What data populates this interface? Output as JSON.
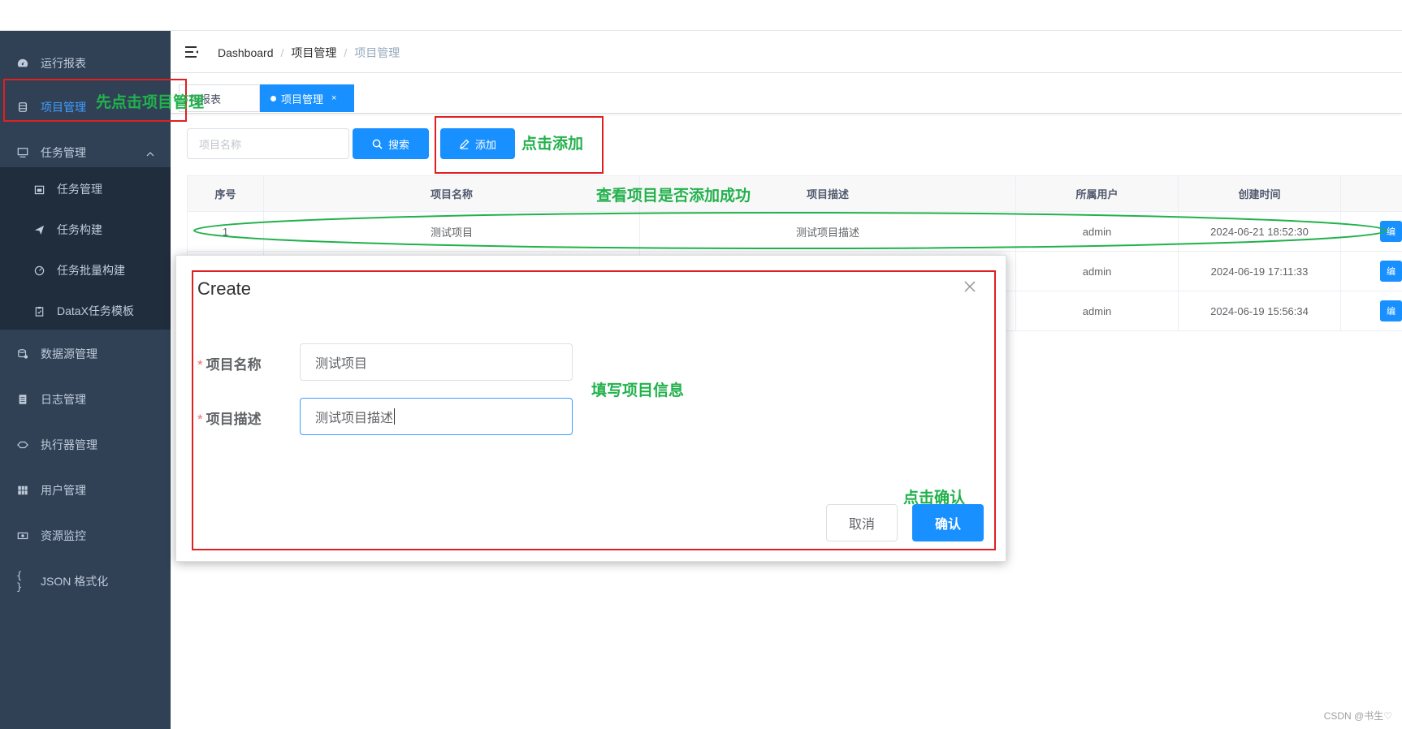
{
  "sidebar": {
    "items": [
      {
        "label": "运行报表",
        "icon": "dashboard-icon"
      },
      {
        "label": "项目管理",
        "icon": "database-icon",
        "active": true
      },
      {
        "label": "任务管理",
        "icon": "monitor-icon"
      },
      {
        "label": "数据源管理",
        "icon": "datasource-icon"
      },
      {
        "label": "日志管理",
        "icon": "document-icon"
      },
      {
        "label": "执行器管理",
        "icon": "executor-icon"
      },
      {
        "label": "用户管理",
        "icon": "users-icon"
      },
      {
        "label": "资源监控",
        "icon": "monitor-resource-icon"
      },
      {
        "label": "JSON 格式化",
        "icon": "braces-icon"
      }
    ],
    "task_submenu": [
      {
        "label": "任务管理",
        "icon": "calendar-icon"
      },
      {
        "label": "任务构建",
        "icon": "send-icon"
      },
      {
        "label": "任务批量构建",
        "icon": "gauge-icon"
      },
      {
        "label": "DataX任务模板",
        "icon": "clipboard-icon"
      }
    ]
  },
  "breadcrumb": [
    "Dashboard",
    "项目管理",
    "项目管理"
  ],
  "tags": [
    {
      "label": "行报表"
    },
    {
      "label": "项目管理",
      "active": true,
      "close": "×"
    }
  ],
  "filter": {
    "placeholder": "项目名称",
    "search_label": "搜索",
    "add_label": "添加"
  },
  "table": {
    "headers": [
      "序号",
      "项目名称",
      "项目描述",
      "所属用户",
      "创建时间"
    ],
    "rows": [
      {
        "index": "1",
        "name": "测试项目",
        "desc": "测试项目描述",
        "user": "admin",
        "created": "2024-06-21 18:52:30",
        "edit": "编"
      },
      {
        "index": "",
        "name": "",
        "desc": "",
        "user": "admin",
        "created": "2024-06-19 17:11:33",
        "edit": "编"
      },
      {
        "index": "",
        "name": "",
        "desc": "",
        "user": "admin",
        "created": "2024-06-19 15:56:34",
        "edit": "编"
      }
    ]
  },
  "dialog": {
    "title": "Create",
    "fields": [
      {
        "label": "项目名称",
        "value": "测试项目"
      },
      {
        "label": "项目描述",
        "value": "测试项目描述"
      }
    ],
    "required_mark": "*",
    "cancel_label": "取消",
    "confirm_label": "确认"
  },
  "annotations": {
    "click_project": "先点击项目管理",
    "click_add": "点击添加",
    "check_added": "查看项目是否添加成功",
    "fill_info": "填写项目信息",
    "click_confirm": "点击确认"
  },
  "watermark": "CSDN @书生♡",
  "colors": {
    "sidebar_bg": "#304156",
    "submenu_bg": "#1f2d3d",
    "primary": "#1890ff",
    "annotation_red": "#e02020",
    "annotation_green": "#22b14c"
  }
}
